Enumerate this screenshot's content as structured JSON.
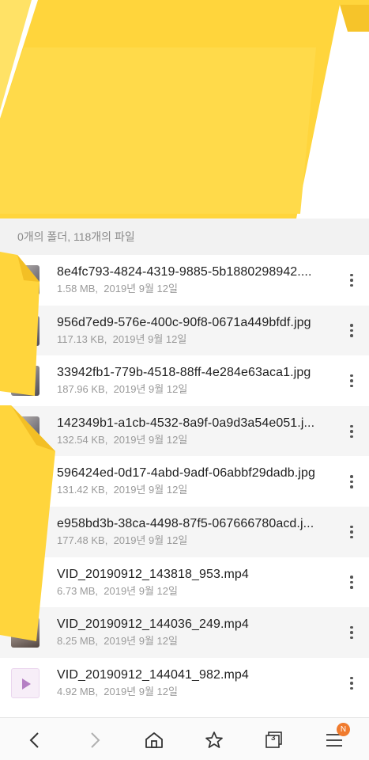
{
  "summary": {
    "text": "0개의 폴더, 118개의 파일"
  },
  "files": [
    {
      "name": "8e4fc793-4824-4319-9885-5b1880298942....",
      "size": "1.58 MB,",
      "date": "2019년 9월 12일",
      "thumb": "image"
    },
    {
      "name": "956d7ed9-576e-400c-90f8-0671a449bfdf.jpg",
      "size": "117.13 KB,",
      "date": "2019년 9월 12일",
      "thumb": "image"
    },
    {
      "name": "33942fb1-779b-4518-88ff-4e284e63aca1.jpg",
      "size": "187.96 KB,",
      "date": "2019년 9월 12일",
      "thumb": "image"
    },
    {
      "name": "142349b1-a1cb-4532-8a9f-0a9d3a54e051.j...",
      "size": "132.54 KB,",
      "date": "2019년 9월 12일",
      "thumb": "image"
    },
    {
      "name": "596424ed-0d17-4abd-9adf-06abbf29dadb.jpg",
      "size": "131.42 KB,",
      "date": "2019년 9월 12일",
      "thumb": "image"
    },
    {
      "name": "e958bd3b-38ca-4498-87f5-067666780acd.j...",
      "size": "177.48 KB,",
      "date": "2019년 9월 12일",
      "thumb": "image"
    },
    {
      "name": "VID_20190912_143818_953.mp4",
      "size": "6.73 MB,",
      "date": "2019년 9월 12일",
      "thumb": "video"
    },
    {
      "name": "VID_20190912_144036_249.mp4",
      "size": "8.25 MB,",
      "date": "2019년 9월 12일",
      "thumb": "video"
    },
    {
      "name": "VID_20190912_144041_982.mp4",
      "size": "4.92 MB,",
      "date": "2019년 9월 12일",
      "thumb": "video-generic"
    }
  ],
  "bottom_nav": {
    "tab_count": "3",
    "menu_badge": "N"
  },
  "colors": {
    "sticker": "#ffd84a",
    "badge": "#f07b2e",
    "summary_bg": "#f2f2f2"
  },
  "icons": [
    "back-icon",
    "forward-icon",
    "home-icon",
    "bookmark-star-icon",
    "tabs-icon",
    "menu-icon",
    "more-vertical-icon",
    "play-icon"
  ]
}
